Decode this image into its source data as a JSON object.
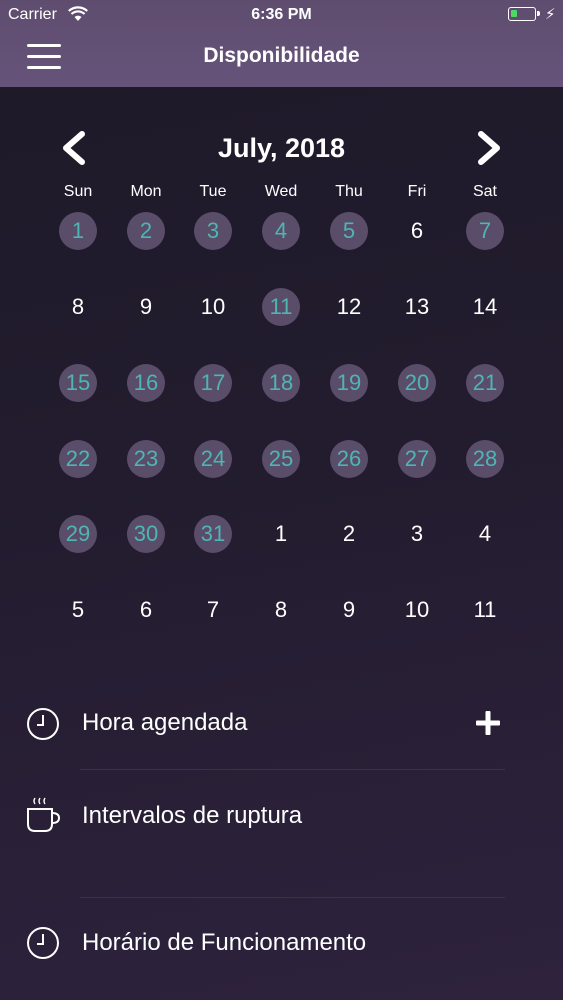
{
  "status_bar": {
    "carrier": "Carrier",
    "time": "6:36 PM",
    "battery_level": 0.25,
    "battery_color": "#4cd964"
  },
  "header": {
    "title": "Disponibilidade",
    "menu_icon": "hamburger-menu-icon",
    "background": "#5f4d6f"
  },
  "calendar": {
    "month_label": "July, 2018",
    "prev_icon": "chevron-left-icon",
    "next_icon": "chevron-right-icon",
    "weekdays": [
      "Sun",
      "Mon",
      "Tue",
      "Wed",
      "Thu",
      "Fri",
      "Sat"
    ],
    "highlight_circle_color": "#5a4d6a",
    "highlight_text_color": "#4fb5b2",
    "weeks": [
      [
        {
          "day": "1",
          "active": true
        },
        {
          "day": "2",
          "active": true
        },
        {
          "day": "3",
          "active": true
        },
        {
          "day": "4",
          "active": true
        },
        {
          "day": "5",
          "active": true
        },
        {
          "day": "6",
          "active": false
        },
        {
          "day": "7",
          "active": true
        }
      ],
      [
        {
          "day": "8",
          "active": false
        },
        {
          "day": "9",
          "active": false
        },
        {
          "day": "10",
          "active": false
        },
        {
          "day": "11",
          "active": true
        },
        {
          "day": "12",
          "active": false
        },
        {
          "day": "13",
          "active": false
        },
        {
          "day": "14",
          "active": false
        }
      ],
      [
        {
          "day": "15",
          "active": true
        },
        {
          "day": "16",
          "active": true
        },
        {
          "day": "17",
          "active": true
        },
        {
          "day": "18",
          "active": true
        },
        {
          "day": "19",
          "active": true
        },
        {
          "day": "20",
          "active": true
        },
        {
          "day": "21",
          "active": true
        }
      ],
      [
        {
          "day": "22",
          "active": true
        },
        {
          "day": "23",
          "active": true
        },
        {
          "day": "24",
          "active": true
        },
        {
          "day": "25",
          "active": true
        },
        {
          "day": "26",
          "active": true
        },
        {
          "day": "27",
          "active": true
        },
        {
          "day": "28",
          "active": true
        }
      ],
      [
        {
          "day": "29",
          "active": true
        },
        {
          "day": "30",
          "active": true
        },
        {
          "day": "31",
          "active": true
        },
        {
          "day": "1",
          "active": false
        },
        {
          "day": "2",
          "active": false
        },
        {
          "day": "3",
          "active": false
        },
        {
          "day": "4",
          "active": false
        }
      ],
      [
        {
          "day": "5",
          "active": false
        },
        {
          "day": "6",
          "active": false
        },
        {
          "day": "7",
          "active": false
        },
        {
          "day": "8",
          "active": false
        },
        {
          "day": "9",
          "active": false
        },
        {
          "day": "10",
          "active": false
        },
        {
          "day": "11",
          "active": false
        }
      ]
    ]
  },
  "sections": {
    "scheduled": {
      "label": "Hora agendada",
      "icon": "clock-icon",
      "action_icon": "plus-icon"
    },
    "breaks": {
      "label": "Intervalos de ruptura",
      "icon": "coffee-cup-icon"
    },
    "hours": {
      "label": "Horário de Funcionamento",
      "icon": "clock-icon"
    }
  }
}
